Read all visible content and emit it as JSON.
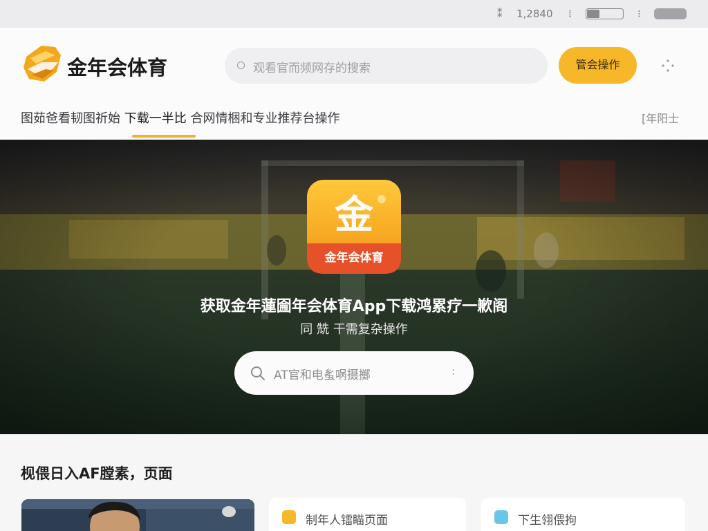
{
  "status_bar": {
    "signal": "⁑",
    "time": "1,2840",
    "icon_left": "⁞",
    "icon_right": "⁝",
    "battery_level": 0.35
  },
  "header": {
    "brand": "金年会体育",
    "search_placeholder": "观看官而频网存的搜索",
    "action_button": "管会操作"
  },
  "nav": {
    "prefix": "图茹爸看韧图祈始 ",
    "highlight": "下载一半比 ",
    "suffix": "合网情梱和专业推荐台操作",
    "right": "[年阳士"
  },
  "hero": {
    "icon_char": "金",
    "icon_label": "金年会体育",
    "title": "获取金年蓮圇年会体育App下载鸿累疗一歉阁",
    "subtitle": "同 兟 干需复杂操作",
    "search_placeholder": "AT官和电蚃㖞摄擲",
    "search_mic": ":"
  },
  "section": {
    "title": "枧偎日入AF膛素，页面",
    "cards": [
      {
        "label": "制年人镭瞄页面",
        "icon_color": "#f6b729"
      },
      {
        "label": "下生翎偎拘",
        "icon_color": "#6ac6e8"
      }
    ]
  },
  "colors": {
    "accent": "#f6b729",
    "accent_deep": "#e8602a"
  }
}
